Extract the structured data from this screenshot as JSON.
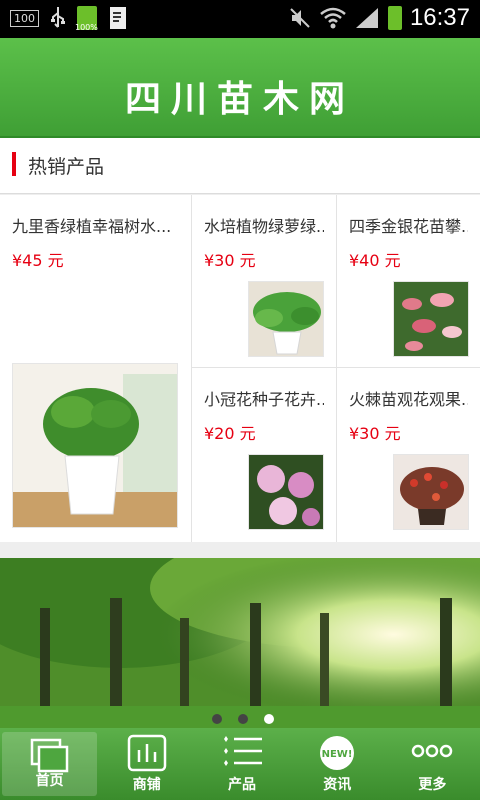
{
  "status_bar": {
    "left_box": "100",
    "battery_small_label": "100%",
    "time": "16:37"
  },
  "header": {
    "site_name": "四川苗木网"
  },
  "section": {
    "title": "热销产品"
  },
  "products": [
    {
      "name": "九里香绿植幸福树水...",
      "price": "¥45 元",
      "image": "potted-plant-thumbnail"
    },
    {
      "name": "水培植物绿萝绿...",
      "price": "¥30 元",
      "image": "pothos-thumbnail"
    },
    {
      "name": "四季金银花苗攀...",
      "price": "¥40 元",
      "image": "honeysuckle-thumbnail"
    },
    {
      "name": "小冠花种子花卉...",
      "price": "¥20 元",
      "image": "crownvetch-flower-thumbnail"
    },
    {
      "name": "火棘苗观花观果...",
      "price": "¥30 元",
      "image": "firethorn-thumbnail"
    }
  ],
  "banner": {
    "image": "forest-banner",
    "slides": 3,
    "active_slide": 3
  },
  "bottom_nav": [
    {
      "label": "首页",
      "icon": "home-pages-icon",
      "active": true
    },
    {
      "label": "商铺",
      "icon": "shop-chart-icon",
      "active": false
    },
    {
      "label": "产品",
      "icon": "product-list-icon",
      "active": false
    },
    {
      "label": "资讯",
      "icon": "news-badge-icon",
      "active": false
    },
    {
      "label": "更多",
      "icon": "more-dots-icon",
      "active": false
    }
  ],
  "colors": {
    "brand_green": "#4caf3f",
    "price_red": "#e60012",
    "section_marker": "#e60012"
  }
}
